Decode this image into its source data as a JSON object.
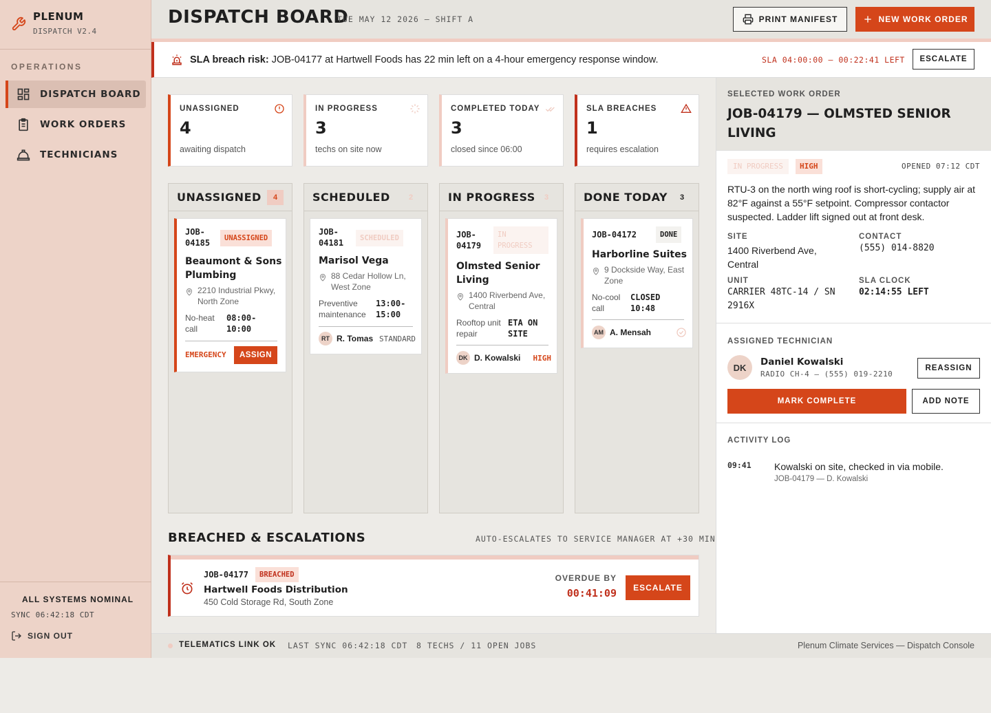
{
  "sidebar": {
    "brand_name": "PLENUM",
    "brand_version": "DISPATCH V2.4",
    "section_label": "OPERATIONS",
    "items": [
      {
        "label": "DISPATCH BOARD",
        "icon": "grid-icon",
        "active": true
      },
      {
        "label": "WORK ORDERS",
        "icon": "clipboard-icon",
        "active": false
      },
      {
        "label": "TECHNICIANS",
        "icon": "hardhat-icon",
        "active": false
      }
    ],
    "status": "ALL SYSTEMS NOMINAL",
    "sync": "SYNC 06:42:18 CDT",
    "sign_out": "SIGN OUT"
  },
  "header": {
    "title": "DISPATCH BOARD",
    "date": "TUE MAY 12 2026 — SHIFT A",
    "print_label": "PRINT MANIFEST",
    "new_label": "NEW WORK ORDER"
  },
  "alert": {
    "prefix": "SLA breach risk:",
    "message": "JOB-04177 at Hartwell Foods has 22 min left on a 4-hour emergency response window.",
    "sla": "SLA 04:00:00 — 00:22:41 LEFT",
    "escalate": "ESCALATE"
  },
  "stats": [
    {
      "label": "UNASSIGNED",
      "value": "4",
      "sub": "awaiting dispatch",
      "icon": "alert-circle-icon"
    },
    {
      "label": "IN PROGRESS",
      "value": "3",
      "sub": "techs on site now",
      "icon": "spinner-icon"
    },
    {
      "label": "COMPLETED TODAY",
      "value": "3",
      "sub": "closed since 06:00",
      "icon": "double-check-icon"
    },
    {
      "label": "SLA BREACHES",
      "value": "1",
      "sub": "requires escalation",
      "icon": "warning-triangle-icon"
    }
  ],
  "columns": [
    {
      "title": "UNASSIGNED",
      "count": "4",
      "card": {
        "job": "JOB-04185",
        "tag": "UNASSIGNED",
        "name": "Beaumont & Sons Plumbing",
        "address": "2210 Industrial Pkwy, North Zone",
        "type": "No-heat call",
        "time": "08:00-10:00",
        "priority": "EMERGENCY",
        "action": "ASSIGN"
      }
    },
    {
      "title": "SCHEDULED",
      "count": "2",
      "card": {
        "job": "JOB-04181",
        "tag": "SCHEDULED",
        "name": "Marisol Vega",
        "address": "88 Cedar Hollow Ln, West Zone",
        "type": "Preventive maintenance",
        "time": "13:00-15:00",
        "tech_initials": "RT",
        "tech": "R. Tomas",
        "priority": "STANDARD"
      }
    },
    {
      "title": "IN PROGRESS",
      "count": "3",
      "card": {
        "job": "JOB-04179",
        "tag": "IN PROGRESS",
        "name": "Olmsted Senior Living",
        "address": "1400 Riverbend Ave, Central",
        "type": "Rooftop unit repair",
        "time": "ETA ON SITE",
        "tech_initials": "DK",
        "tech": "D. Kowalski",
        "priority": "HIGH"
      }
    },
    {
      "title": "DONE TODAY",
      "count": "3",
      "card": {
        "job": "JOB-04172",
        "tag": "DONE",
        "name": "Harborline Suites",
        "address": "9 Dockside Way, East Zone",
        "type": "No-cool call",
        "time": "CLOSED 10:48",
        "tech_initials": "AM",
        "tech": "A. Mensah"
      }
    }
  ],
  "breached": {
    "title": "BREACHED & ESCALATIONS",
    "note": "AUTO-ESCALATES TO SERVICE MANAGER AT +30 MIN",
    "job": "JOB-04177",
    "tag": "BREACHED",
    "name": "Hartwell Foods Distribution",
    "address": "450 Cold Storage Rd, South Zone",
    "overdue_label": "OVERDUE BY",
    "overdue": "00:41:09",
    "action": "ESCALATE"
  },
  "detail": {
    "label": "SELECTED WORK ORDER",
    "title": "JOB-04179 — OLMSTED SENIOR LIVING",
    "status": "IN PROGRESS",
    "priority": "HIGH",
    "opened": "OPENED 07:12 CDT",
    "description": "RTU-3 on the north wing roof is short-cycling; supply air at 82°F against a 55°F setpoint. Compressor contactor suspected. Ladder lift signed out at front desk.",
    "site_label": "SITE",
    "site": "1400 Riverbend Ave, Central",
    "contact_label": "CONTACT",
    "contact": "(555) 014-8820",
    "unit_label": "UNIT",
    "unit": "CARRIER 48TC-14 / SN 2916X",
    "sla_label": "SLA CLOCK",
    "sla": "02:14:55 LEFT",
    "tech_section": "ASSIGNED TECHNICIAN",
    "tech_initials": "DK",
    "tech_name": "Daniel Kowalski",
    "tech_radio": "RADIO CH-4 — (555) 019-2210",
    "reassign": "REASSIGN",
    "complete": "MARK COMPLETE",
    "add_note": "ADD NOTE",
    "activity_label": "ACTIVITY LOG",
    "activity": [
      {
        "time": "09:41",
        "text": "Kowalski on site, checked in via mobile.",
        "sub": "JOB-04179 — D. Kowalski"
      }
    ]
  },
  "footer": {
    "link": "TELEMATICS LINK OK",
    "last_sync": "LAST SYNC 06:42:18 CDT",
    "counts": "8 TECHS / 11 OPEN JOBS",
    "company": "Plenum Climate Services — Dispatch Console"
  },
  "colors": {
    "accent": "#d5461a",
    "danger": "#c0301c",
    "sidebar": "#edd3c8",
    "pink": "#f0ccc2"
  }
}
